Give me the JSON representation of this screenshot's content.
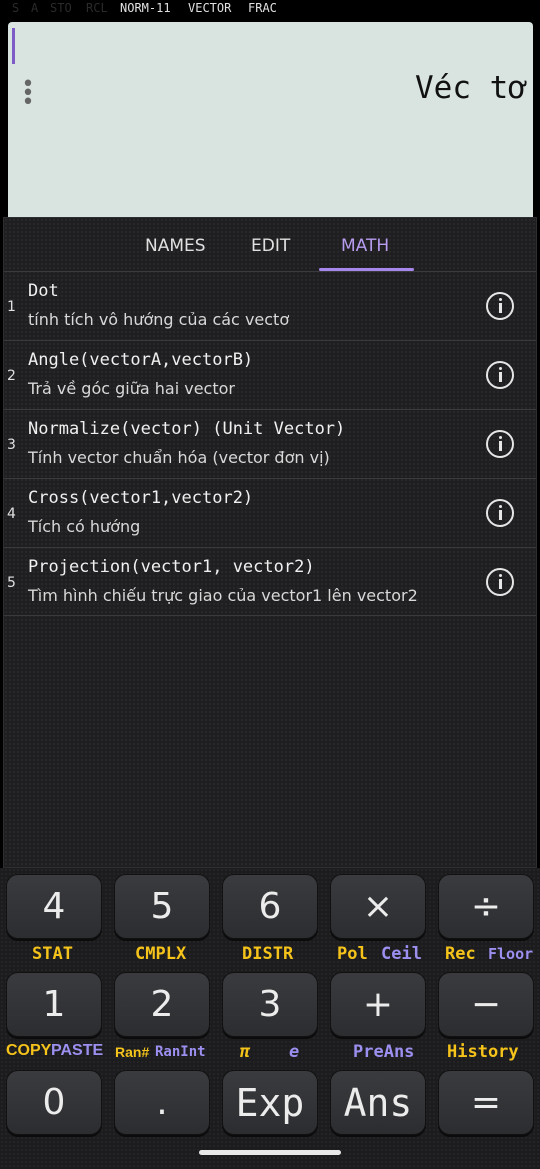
{
  "status": {
    "indicators_off": [
      "S",
      "A",
      "STO",
      "RCL"
    ],
    "indicators_on": [
      "NORM-11",
      "VECTOR",
      "FRAC"
    ]
  },
  "display": {
    "text": "Véc tơ",
    "menu_icon": "vertical-dots-icon"
  },
  "tabs": [
    {
      "label": "NAMES",
      "active": false
    },
    {
      "label": "EDIT",
      "active": false
    },
    {
      "label": "MATH",
      "active": true
    }
  ],
  "functions": [
    {
      "num": "1",
      "title": "Dot",
      "desc": "tính tích vô hướng của các vectơ"
    },
    {
      "num": "2",
      "title": "Angle(vectorA,vectorB)",
      "desc": "Trả về góc giữa hai vector"
    },
    {
      "num": "3",
      "title": "Normalize(vector) (Unit Vector)",
      "desc": "Tính vector chuẩn hóa (vector đơn vị)"
    },
    {
      "num": "4",
      "title": "Cross(vector1,vector2)",
      "desc": "Tích có hướng"
    },
    {
      "num": "5",
      "title": "Projection(vector1, vector2)",
      "desc": "Tìm hình chiếu trực giao của vector1 lên vector2"
    }
  ],
  "keypad": {
    "row1": [
      "4",
      "5",
      "6",
      "×",
      "÷"
    ],
    "shift1": {
      "k1": "STAT",
      "k2": "CMPLX",
      "k3": "DISTR",
      "k4a": "Pol",
      "k4b": "Ceil",
      "k5a": "Rec",
      "k5b": "Floor"
    },
    "row2": [
      "1",
      "2",
      "3",
      "+",
      "−"
    ],
    "shift2": {
      "k1a": "COPY",
      "k1b": "PASTE",
      "k2a": "Ran#",
      "k2b": "RanInt",
      "k3a": "π",
      "k3b": "e",
      "k4": "PreAns",
      "k5": "History"
    },
    "row3": [
      "0",
      ".",
      "Exp",
      "Ans",
      "="
    ]
  },
  "colors": {
    "accent": "#a787ec",
    "shift_yellow": "#f5c31a",
    "shift_blue": "#9b8ff0",
    "display_bg": "#d9e4e1"
  }
}
